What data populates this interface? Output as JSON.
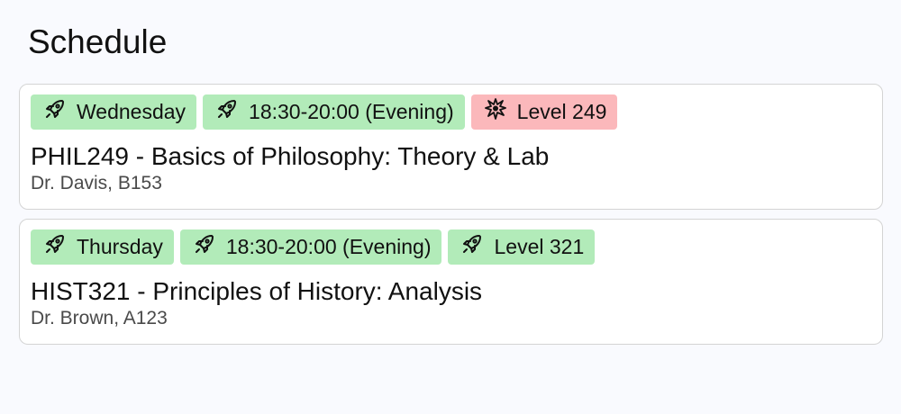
{
  "page": {
    "title": "Schedule"
  },
  "colors": {
    "tag_green": "#b2ebb9",
    "tag_red": "#fbb8bb",
    "card_border": "#d4d4d4",
    "background": "#f9fafe"
  },
  "courses": [
    {
      "tags": [
        {
          "icon": "rocket-icon",
          "label": "Wednesday",
          "color": "green"
        },
        {
          "icon": "rocket-icon",
          "label": "18:30-20:00 (Evening)",
          "color": "green"
        },
        {
          "icon": "explosion-icon",
          "label": "Level 249",
          "color": "red"
        }
      ],
      "title": "PHIL249 - Basics of Philosophy: Theory & Lab",
      "meta": "Dr. Davis, B153"
    },
    {
      "tags": [
        {
          "icon": "rocket-icon",
          "label": "Thursday",
          "color": "green"
        },
        {
          "icon": "rocket-icon",
          "label": "18:30-20:00 (Evening)",
          "color": "green"
        },
        {
          "icon": "rocket-icon",
          "label": "Level 321",
          "color": "green"
        }
      ],
      "title": "HIST321 - Principles of History: Analysis",
      "meta": "Dr. Brown, A123"
    }
  ]
}
